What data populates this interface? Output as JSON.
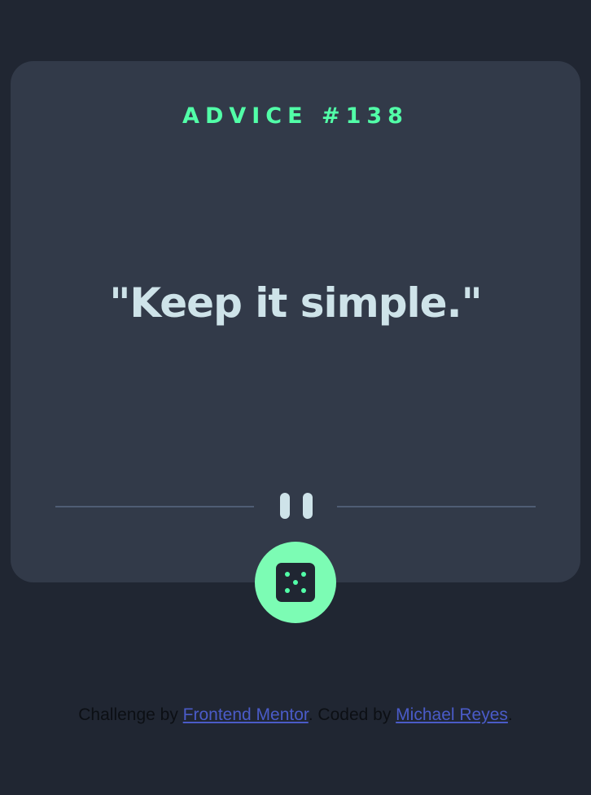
{
  "card": {
    "advice_label": "ADVICE #138",
    "quote": "\"Keep it simple.\""
  },
  "dice_button": {
    "icon": "dice-icon",
    "color": "#52ffa8"
  },
  "footer": {
    "prefix": "Challenge by ",
    "challenge_link": "Frontend Mentor",
    "middle": ". Coded by ",
    "author_link": "Michael Reyes",
    "suffix": "."
  },
  "colors": {
    "background": "#202632",
    "card": "#323a49",
    "accent": "#52ffa8",
    "quote_text": "#cee3e9",
    "link": "#4a5bc8"
  }
}
